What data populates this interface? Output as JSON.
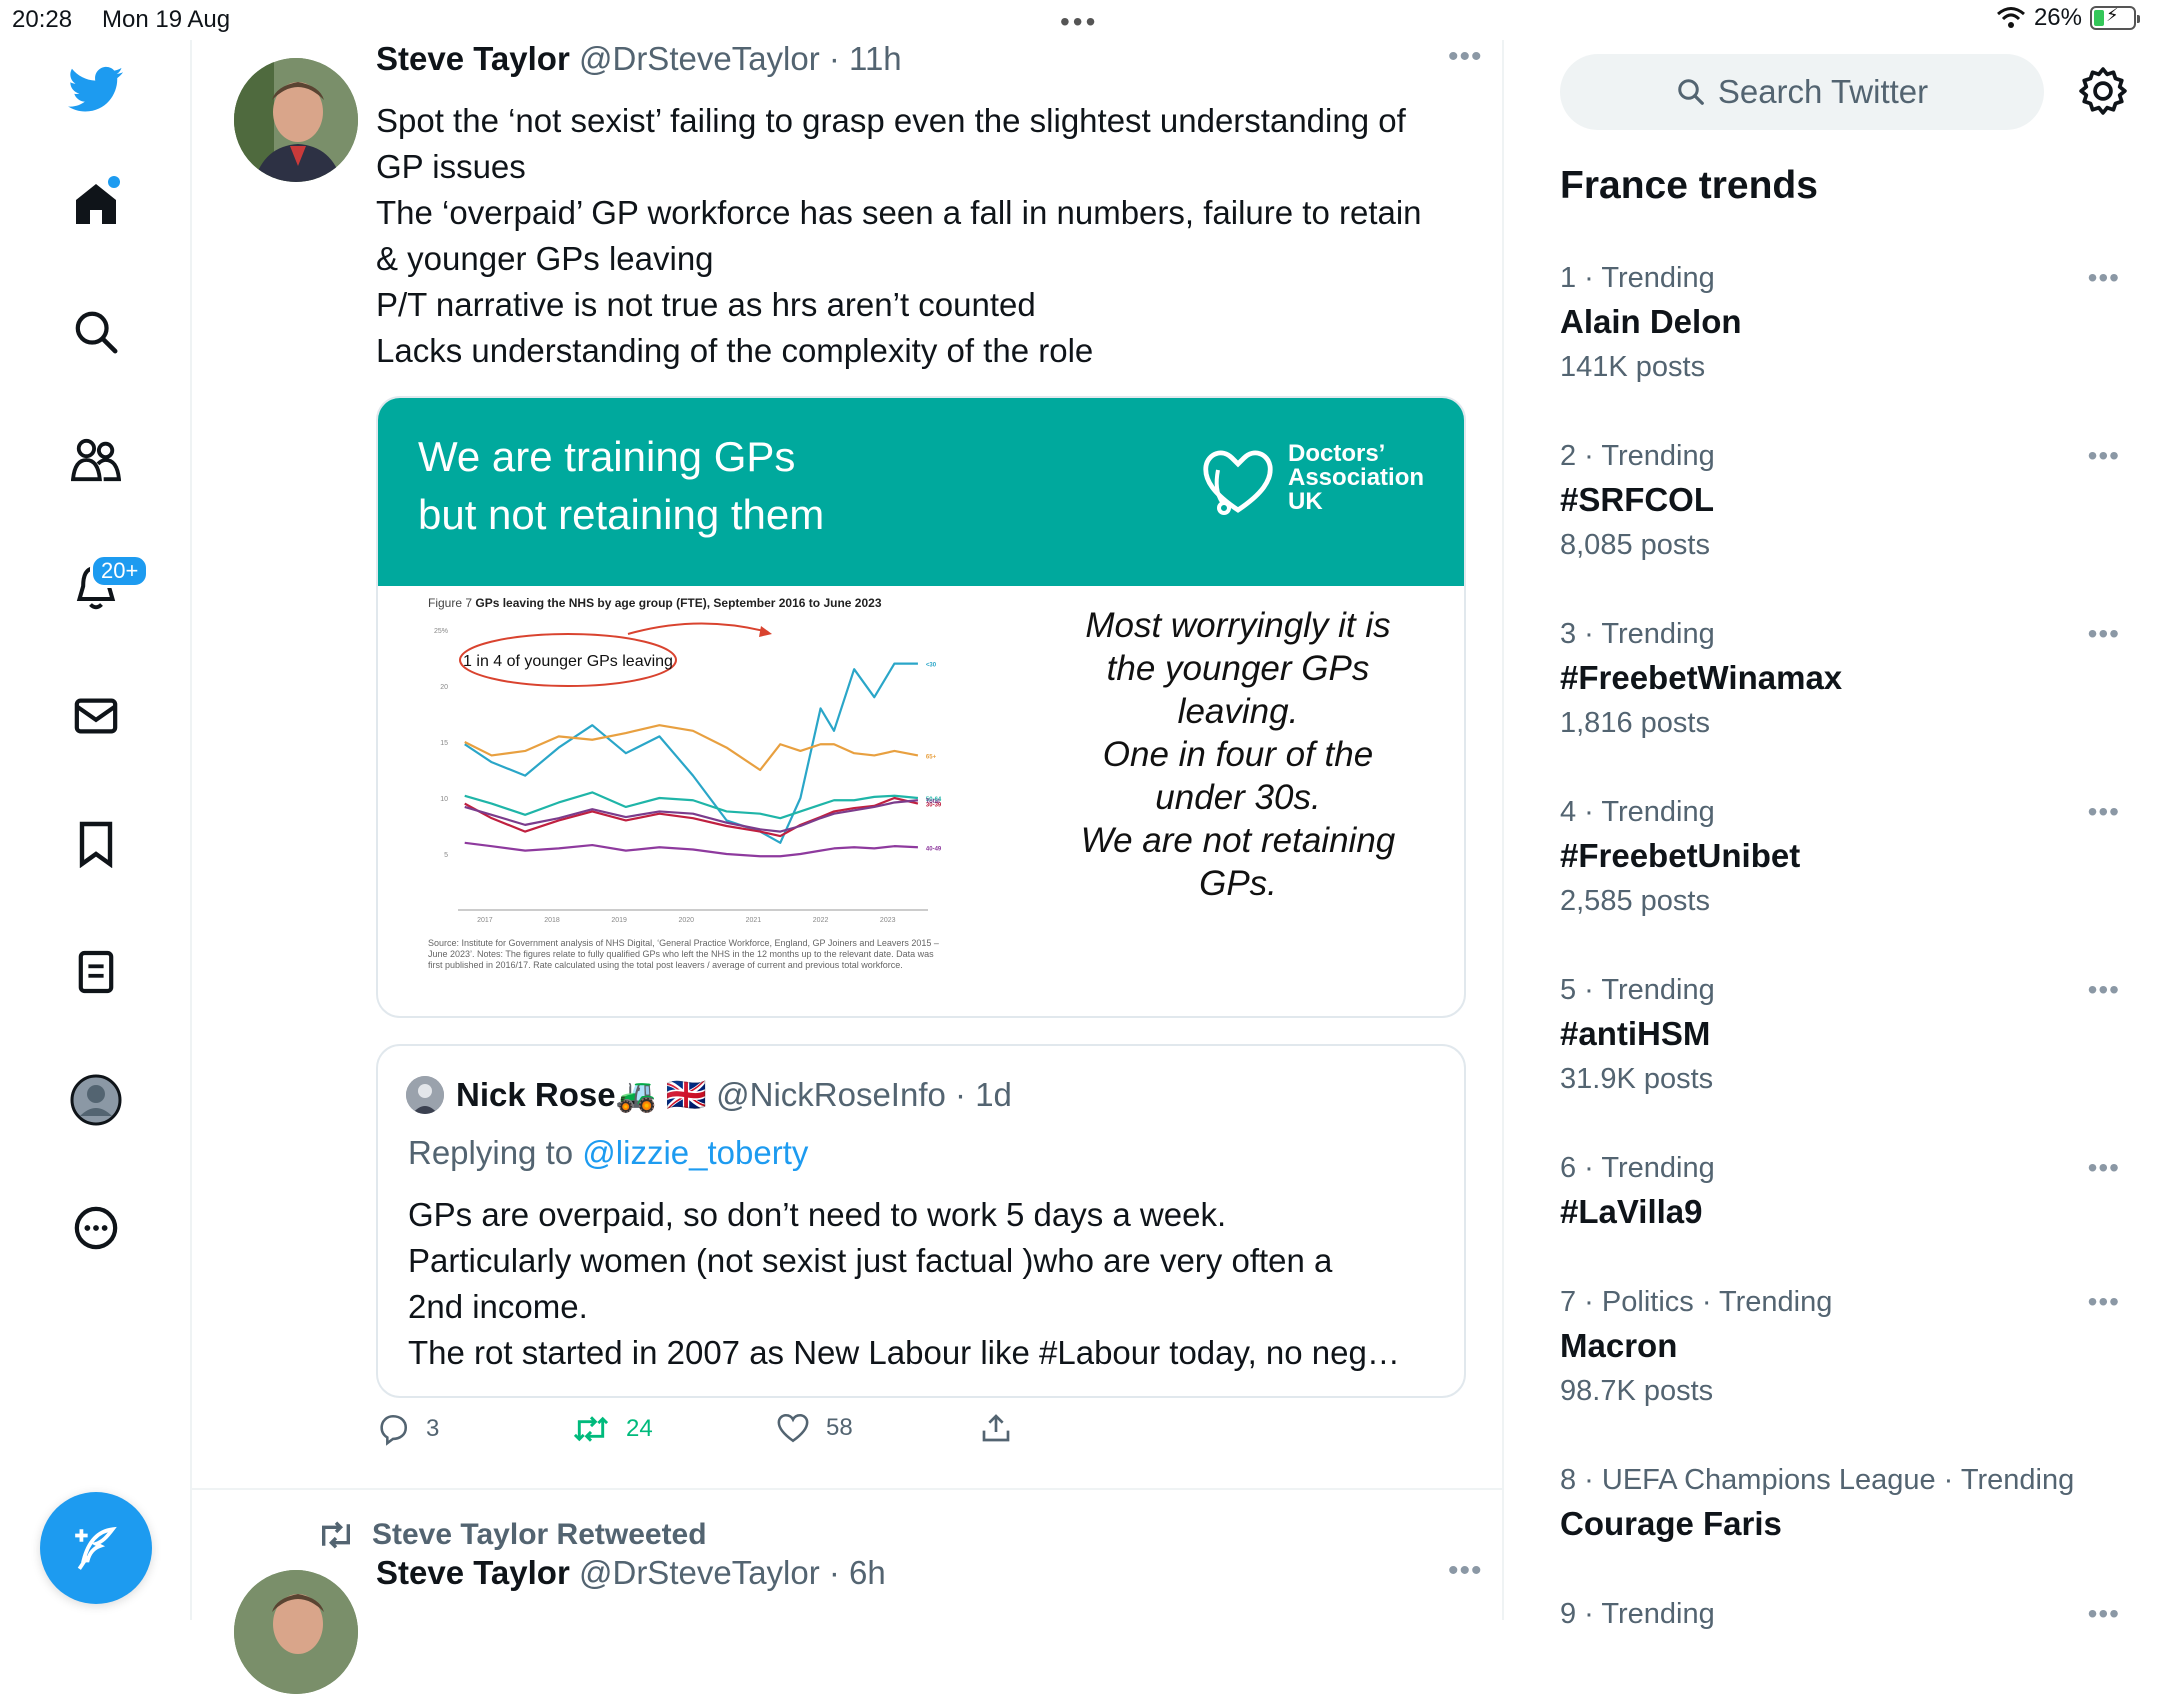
{
  "status_bar": {
    "time": "20:28",
    "date": "Mon 19 Aug",
    "battery": "26%",
    "battery_level": 0.26
  },
  "nav": {
    "notifications_badge": "20+"
  },
  "tweet": {
    "author_name": "Steve Taylor",
    "author_handle": "@DrSteveTaylor",
    "time": "11h",
    "text_lines": [
      "Spot the ‘not sexist’ failing to grasp even the slightest understanding of",
      "GP issues",
      "The ‘overpaid’ GP workforce has seen a fall in numbers, failure to retain",
      "& younger GPs leaving",
      "P/T narrative is not true as hrs aren’t counted",
      "Lacks understanding of the complexity of the role"
    ],
    "media": {
      "banner_line1": "We are training GPs",
      "banner_line2": "but not retaining them",
      "org_line1": "Doctors’",
      "org_line2": "Association",
      "org_line3": "UK",
      "figure_prefix": "Figure 7",
      "figure_title": "GPs leaving the NHS by age group (FTE), September 2016 to June 2023",
      "ellipse_label": "1 in 4 of younger GPs leaving",
      "source_note": "Source: Institute for Government analysis of NHS Digital, ‘General Practice Workforce, England, GP Joiners and Leavers 2015 – June 2023’. Notes: The figures relate to fully qualified GPs who left the NHS in the 12 months up to the relevant date. Data was first published in 2016/17. Rate calculated using the total post leavers / average of current and previous total workforce.",
      "callout_lines": [
        "Most worryingly it is",
        "the younger GPs",
        "leaving.",
        "One in four of the",
        "under 30s.",
        "We are not retaining",
        "GPs."
      ]
    },
    "quote": {
      "author_name": "Nick Rose",
      "author_emoji": "🚜 🇬🇧",
      "author_handle": "@NickRoseInfo",
      "time": "1d",
      "replying_label": "Replying to",
      "replying_to": "@lizzie_toberty",
      "text_lines": [
        "GPs are overpaid, so don’t need to work 5 days a week.",
        "Particularly women (not sexist just factual )who are very often a",
        "2nd income.",
        "The rot started in 2007 as New Labour like #Labour today, no neg…"
      ]
    },
    "stats": {
      "replies": "3",
      "retweets": "24",
      "likes": "58"
    }
  },
  "next_tweet": {
    "retweeted_label": "Steve Taylor Retweeted",
    "author_name": "Steve Taylor",
    "author_handle": "@DrSteveTaylor",
    "time": "6h"
  },
  "sidebar": {
    "search_placeholder": "Search Twitter",
    "trends_title": "France trends",
    "trends": [
      {
        "meta": "1 · Trending",
        "name": "Alain Delon",
        "count": "141K posts"
      },
      {
        "meta": "2 · Trending",
        "name": "#SRFCOL",
        "count": "8,085 posts"
      },
      {
        "meta": "3 · Trending",
        "name": "#FreebetWinamax",
        "count": "1,816 posts"
      },
      {
        "meta": "4 · Trending",
        "name": "#FreebetUnibet",
        "count": "2,585 posts"
      },
      {
        "meta": "5 · Trending",
        "name": "#antiHSM",
        "count": "31.9K posts"
      },
      {
        "meta": "6 · Trending",
        "name": "#LaVilla9",
        "count": ""
      },
      {
        "meta": "7 · Politics · Trending",
        "name": "Macron",
        "count": "98.7K posts"
      },
      {
        "meta": "8 · UEFA Champions League · Trending",
        "name": "Courage Faris",
        "count": ""
      },
      {
        "meta": "9 · Trending",
        "name": "",
        "count": ""
      }
    ]
  },
  "chart_data": {
    "type": "line",
    "title": "GPs leaving the NHS by age group (FTE), September 2016 to June 2023",
    "ylim": [
      0,
      25
    ],
    "y_ticks": [
      "5",
      "10",
      "15",
      "20",
      "25%"
    ],
    "x_ticks": [
      "2017",
      "2018",
      "2019",
      "2020",
      "2021",
      "2022",
      "2023"
    ],
    "x": [
      2016.7,
      2017.1,
      2017.6,
      2018.1,
      2018.6,
      2019.1,
      2019.6,
      2020.1,
      2020.6,
      2021.1,
      2021.4,
      2021.7,
      2022.0,
      2022.2,
      2022.5,
      2022.8,
      2023.1,
      2023.45
    ],
    "series": [
      {
        "name": "<30",
        "color": "#2aa6c8",
        "values": [
          14.8,
          13.2,
          12.0,
          14.5,
          16.5,
          14.0,
          15.5,
          12.0,
          8.0,
          7.0,
          6.0,
          10.0,
          18.0,
          16.0,
          21.5,
          19.0,
          22.0,
          22.0
        ]
      },
      {
        "name": "65+",
        "color": "#e8a040",
        "values": [
          15.0,
          13.8,
          14.2,
          15.5,
          15.2,
          15.8,
          16.5,
          16.0,
          14.5,
          12.5,
          14.8,
          14.2,
          14.8,
          14.8,
          14.0,
          13.8,
          14.2,
          13.8
        ]
      },
      {
        "name": "50-64",
        "color": "#1fb5a8",
        "values": [
          10.2,
          9.5,
          8.5,
          9.6,
          10.5,
          9.2,
          10.0,
          9.8,
          8.8,
          8.6,
          8.2,
          8.8,
          9.4,
          9.8,
          9.8,
          10.1,
          10.2,
          10.0
        ]
      },
      {
        "name": "30-39",
        "color": "#c02040",
        "values": [
          9.5,
          8.2,
          7.0,
          8.0,
          8.8,
          8.0,
          8.6,
          8.2,
          7.5,
          7.0,
          6.6,
          7.6,
          8.3,
          8.8,
          9.1,
          9.3,
          10.0,
          9.5
        ]
      },
      {
        "name": "Total",
        "color": "#7b3c8c",
        "values": [
          9.2,
          8.5,
          7.6,
          8.2,
          9.0,
          8.3,
          8.8,
          8.6,
          7.8,
          7.2,
          7.0,
          7.5,
          8.2,
          8.6,
          8.9,
          9.2,
          9.6,
          9.8
        ]
      },
      {
        "name": "40-49",
        "color": "#8e3a9e",
        "values": [
          6.0,
          5.7,
          5.3,
          5.5,
          5.8,
          5.3,
          5.6,
          5.4,
          5.0,
          4.8,
          4.8,
          5.0,
          5.3,
          5.5,
          5.6,
          5.5,
          5.7,
          5.6
        ]
      }
    ]
  }
}
